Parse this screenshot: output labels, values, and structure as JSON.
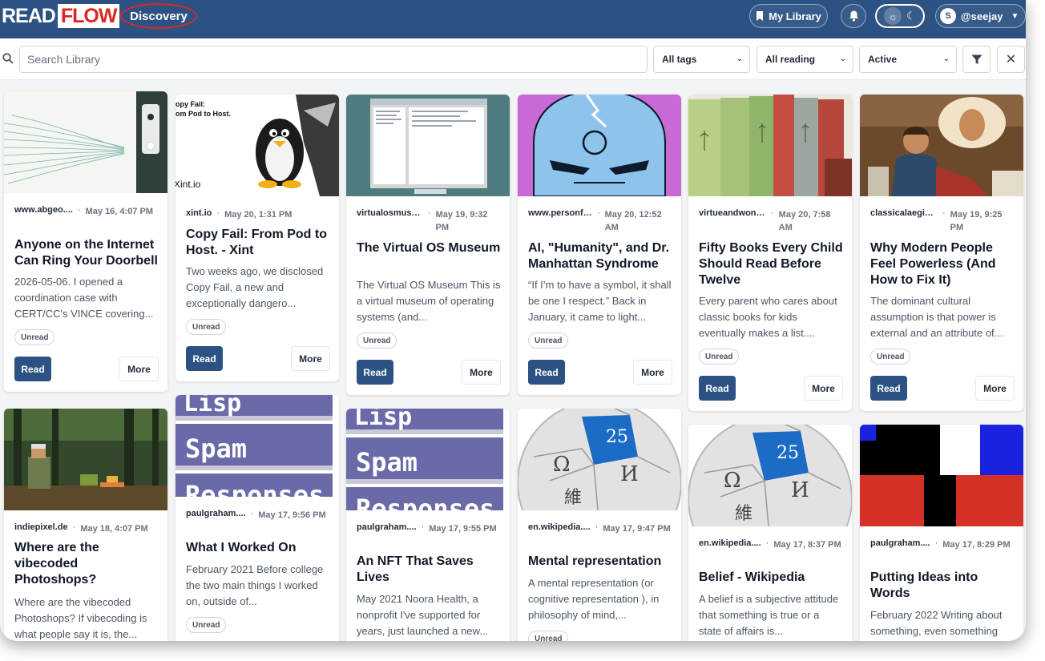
{
  "header": {
    "logo_read": "READ",
    "logo_flow": "FLOW",
    "discovery": "Discovery",
    "my_library": "My Library",
    "user_initial": "S",
    "username": "@seejay"
  },
  "filters": {
    "search_placeholder": "Search Library",
    "tags": "All tags",
    "reading": "All reading",
    "status": "Active"
  },
  "labels": {
    "read": "Read",
    "more": "More",
    "unread": "Unread"
  },
  "cards": [
    {
      "site": "www.abgeo....",
      "date": "May 16, 4:07 PM",
      "title": "Anyone on the Internet Can Ring Your Doorbell",
      "excerpt": "2026-05-06. I opened a coordination case with CERT/CC's VINCE covering..."
    },
    {
      "site": "xint.io",
      "date": "May 20, 1:31 PM",
      "title": "Copy Fail: From Pod to Host. - Xint",
      "excerpt": "Two weeks ago, we disclosed Copy Fail, a new and exceptionally dangero...",
      "thumb_text_1": "opy Fail:",
      "thumb_text_2": "om Pod to Host.",
      "thumb_text_3": "Xint.io"
    },
    {
      "site": "virtualosmuse...",
      "date": "May 19, 9:32 PM",
      "title": "The Virtual OS Museum",
      "excerpt": "The Virtual OS Museum This is a virtual museum of operating systems (and..."
    },
    {
      "site": "www.personfa...",
      "date": "May 20, 12:52 AM",
      "title": "AI, \"Humanity\", and Dr. Manhattan Syndrome",
      "excerpt": "“If I’m to have a symbol, it shall be one I respect.” Back in January, it came to light..."
    },
    {
      "site": "virtueandwond...",
      "date": "May 20, 7:58 AM",
      "title": "Fifty Books Every Child Should Read Before Twelve",
      "excerpt": "Every parent who cares about classic books for kids eventually makes a list...."
    },
    {
      "site": "classicalaegis.su...",
      "date": "May 19, 9:25 PM",
      "title": "Why Modern People Feel Powerless (And How to Fix It)",
      "excerpt": "The dominant cultural assumption is that power is external and an attribute of..."
    },
    {
      "site": "indiepixel.de",
      "date": "May 18, 4:07 PM",
      "title": "Where are the vibecoded Photoshops?",
      "excerpt": "Where are the vibecoded Photoshops? If vibecoding is what people say it is, the..."
    },
    {
      "site": "paulgraham....",
      "date": "May 17, 9:56 PM",
      "title": "What I Worked On",
      "excerpt": "February 2021 Before college the two main things I worked on, outside of...",
      "thumb_words": [
        "Lisp",
        "Spam",
        "Responses"
      ]
    },
    {
      "site": "paulgraham....",
      "date": "May 17, 9:55 PM",
      "title": "An NFT That Saves Lives",
      "excerpt": "May 2021 Noora Health, a nonprofit I've supported for years, just launched a new...",
      "thumb_words": [
        "Lisp",
        "Spam",
        "Responses"
      ]
    },
    {
      "site": "en.wikipedia....",
      "date": "May 17, 9:47 PM",
      "title": "Mental representation",
      "excerpt": "A mental representation (or cognitive representation ), in philosophy of mind,...",
      "thumb_glyphs": [
        "25",
        "Ω",
        "И",
        "維"
      ]
    },
    {
      "site": "en.wikipedia....",
      "date": "May 17, 8:37 PM",
      "title": "Belief - Wikipedia",
      "excerpt": "A belief is a subjective attitude that something is true or a state of affairs is...",
      "thumb_glyphs": [
        "25",
        "Ω",
        "И",
        "維"
      ]
    },
    {
      "site": "paulgraham....",
      "date": "May 17, 8:29 PM",
      "title": "Putting Ideas into Words",
      "excerpt": "February 2022 Writing about something, even something"
    }
  ]
}
